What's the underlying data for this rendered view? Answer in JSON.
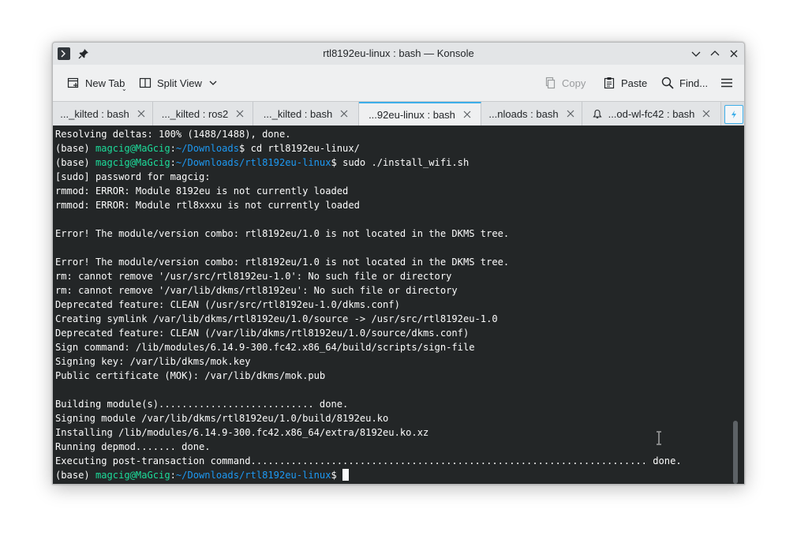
{
  "window": {
    "title": "rtl8192eu-linux : bash — Konsole"
  },
  "toolbar": {
    "new_tab_label": "New Tab",
    "split_view_label": "Split View",
    "copy_label": "Copy",
    "paste_label": "Paste",
    "find_label": "Find..."
  },
  "tabs": [
    {
      "label": "..._kilted : bash",
      "active": false
    },
    {
      "label": "..._kilted : ros2",
      "active": false
    },
    {
      "label": "..._kilted : bash",
      "active": false
    },
    {
      "label": "...92eu-linux : bash",
      "active": true
    },
    {
      "label": "...nloads : bash",
      "active": false
    },
    {
      "label": "...od-wl-fc42 : bash",
      "active": false,
      "icon": "bell-icon"
    }
  ],
  "terminal": {
    "prompt_env": "(base) ",
    "prompt_user": "magcig@MaGcig",
    "prompt_sep": ":",
    "prompt_suffix": "$ ",
    "lines": [
      "Resolving deltas: 100% (1488/1488), done.",
      "",
      "",
      "[sudo] password for magcig:",
      "rmmod: ERROR: Module 8192eu is not currently loaded",
      "rmmod: ERROR: Module rtl8xxxu is not currently loaded",
      "",
      "Error! The module/version combo: rtl8192eu/1.0 is not located in the DKMS tree.",
      "",
      "Error! The module/version combo: rtl8192eu/1.0 is not located in the DKMS tree.",
      "rm: cannot remove '/usr/src/rtl8192eu-1.0': No such file or directory",
      "rm: cannot remove '/var/lib/dkms/rtl8192eu': No such file or directory",
      "Deprecated feature: CLEAN (/usr/src/rtl8192eu-1.0/dkms.conf)",
      "Creating symlink /var/lib/dkms/rtl8192eu/1.0/source -> /usr/src/rtl8192eu-1.0",
      "Deprecated feature: CLEAN (/var/lib/dkms/rtl8192eu/1.0/source/dkms.conf)",
      "Sign command: /lib/modules/6.14.9-300.fc42.x86_64/build/scripts/sign-file",
      "Signing key: /var/lib/dkms/mok.key",
      "Public certificate (MOK): /var/lib/dkms/mok.pub",
      "",
      "Building module(s)........................... done.",
      "Signing module /var/lib/dkms/rtl8192eu/1.0/build/8192eu.ko",
      "Installing /lib/modules/6.14.9-300.fc42.x86_64/extra/8192eu.ko.xz",
      "Running depmod....... done.",
      "Executing post-transaction command..................................................................... done."
    ],
    "prompt1": {
      "path": "~/Downloads",
      "command": "cd rtl8192eu-linux/"
    },
    "prompt2": {
      "path": "~/Downloads/rtl8192eu-linux",
      "command": "sudo ./install_wifi.sh"
    },
    "prompt3": {
      "path": "~/Downloads/rtl8192eu-linux",
      "command": ""
    }
  },
  "colors": {
    "terminal_bg": "#232627",
    "terminal_fg": "#fcfcfc",
    "prompt_user": "#1cdc9a",
    "prompt_path": "#1d99f3",
    "accent": "#3daee9"
  }
}
